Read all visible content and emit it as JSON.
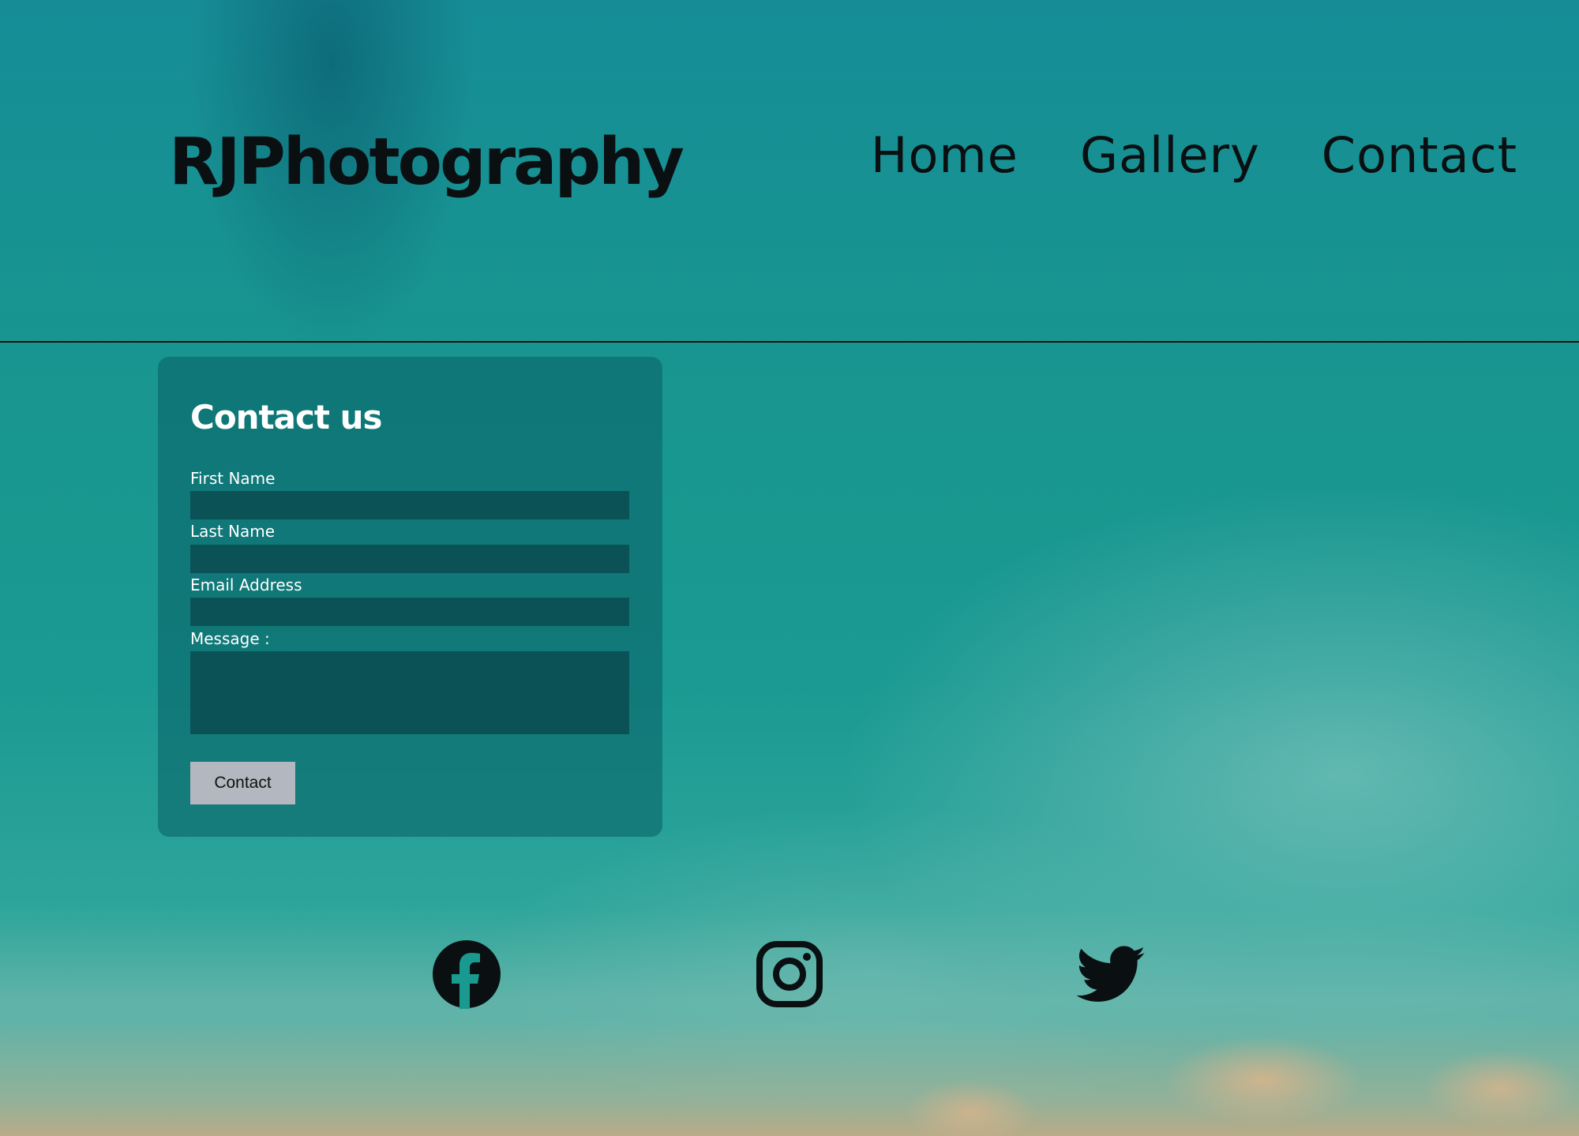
{
  "header": {
    "logo": "RJPhotography",
    "nav": [
      {
        "label": "Home"
      },
      {
        "label": "Gallery"
      },
      {
        "label": "Contact"
      }
    ]
  },
  "contact_form": {
    "title": "Contact us",
    "fields": {
      "first_name": {
        "label": "First Name",
        "value": ""
      },
      "last_name": {
        "label": "Last Name",
        "value": ""
      },
      "email": {
        "label": "Email Address",
        "value": ""
      },
      "message": {
        "label": "Message :",
        "value": ""
      }
    },
    "submit_label": "Contact"
  },
  "social": [
    {
      "icon": "facebook-icon"
    },
    {
      "icon": "instagram-icon"
    },
    {
      "icon": "twitter-icon"
    }
  ],
  "colors": {
    "text_dark": "#0a0f12",
    "form_text": "#ffffff",
    "button_bg": "#b3b7bf",
    "water": "#18968f"
  }
}
